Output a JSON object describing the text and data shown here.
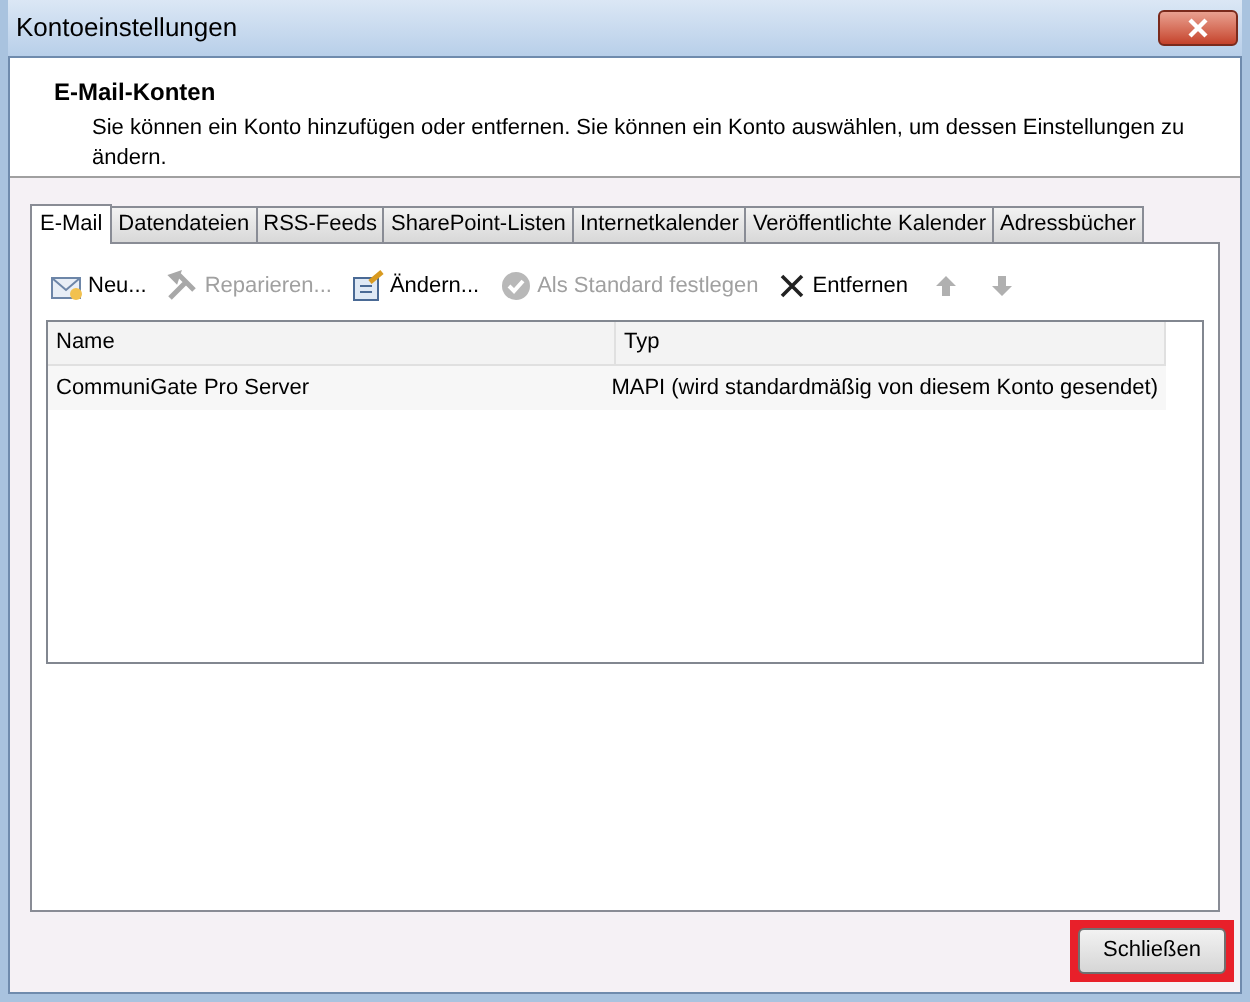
{
  "window": {
    "title": "Kontoeinstellungen"
  },
  "header": {
    "title": "E-Mail-Konten",
    "description": "Sie können ein Konto hinzufügen oder entfernen. Sie können ein Konto auswählen, um dessen Einstellungen zu ändern."
  },
  "tabs": [
    {
      "label": "E-Mail",
      "selected": true
    },
    {
      "label": "Datendateien",
      "selected": false
    },
    {
      "label": "RSS-Feeds",
      "selected": false
    },
    {
      "label": "SharePoint-Listen",
      "selected": false
    },
    {
      "label": "Internetkalender",
      "selected": false
    },
    {
      "label": "Veröffentlichte Kalender",
      "selected": false
    },
    {
      "label": "Adressbücher",
      "selected": false
    }
  ],
  "toolbar": [
    {
      "kind": "new",
      "label": "Neu...",
      "disabled": false
    },
    {
      "kind": "repair",
      "label": "Reparieren...",
      "disabled": true
    },
    {
      "kind": "change",
      "label": "Ändern...",
      "disabled": false
    },
    {
      "kind": "default",
      "label": "Als Standard festlegen",
      "disabled": true
    },
    {
      "kind": "remove",
      "label": "Entfernen",
      "disabled": false
    },
    {
      "kind": "up",
      "disabled": true
    },
    {
      "kind": "down",
      "disabled": true
    }
  ],
  "table": {
    "columns": [
      "Name",
      "Typ"
    ],
    "rows": [
      [
        "CommuniGate Pro Server",
        "MAPI (wird standardmäßig von diesem Konto gesendet)"
      ]
    ]
  },
  "buttons": [
    {
      "label": "Schließen",
      "highlighted": true
    }
  ]
}
